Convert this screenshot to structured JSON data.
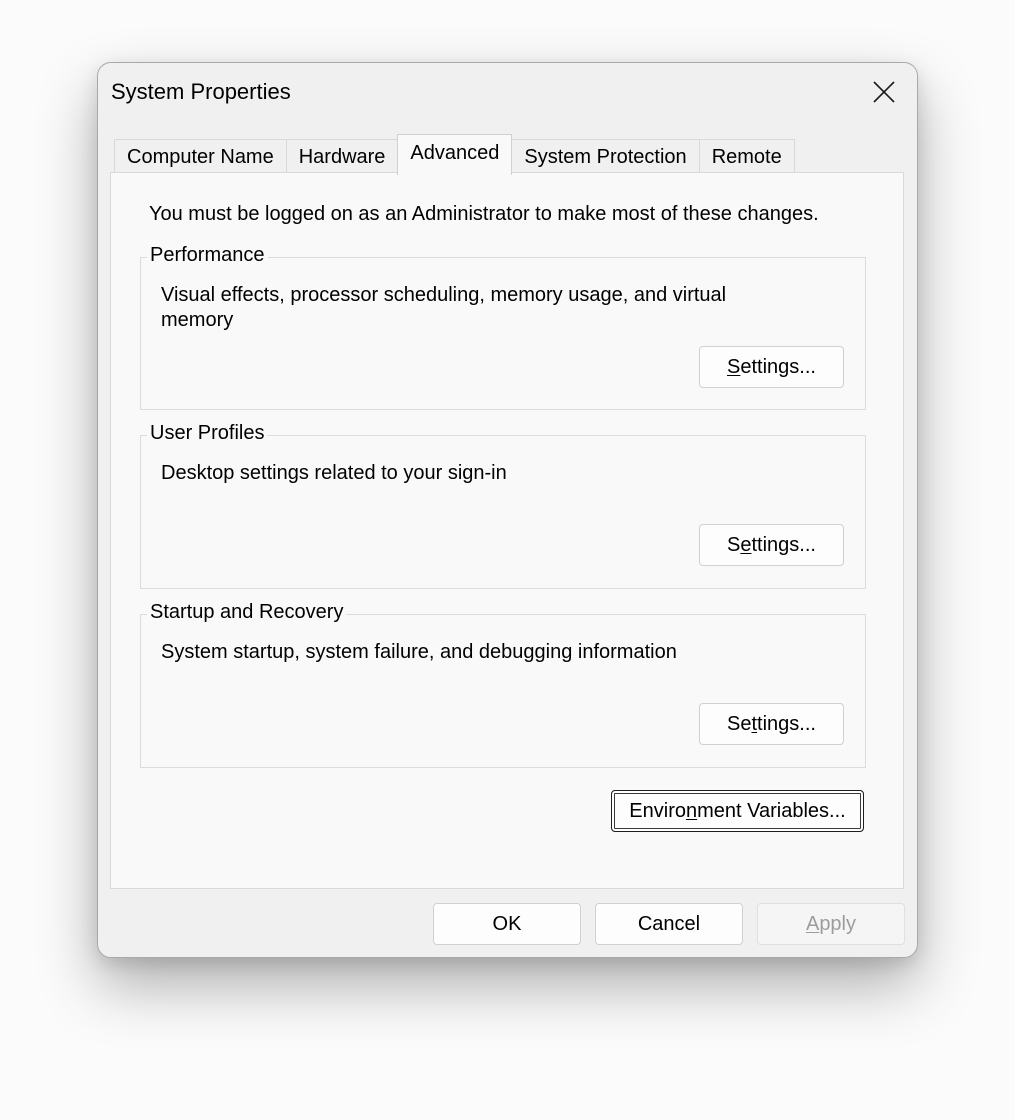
{
  "window": {
    "title": "System Properties",
    "close_icon": "close-icon"
  },
  "tabs": [
    {
      "label": "Computer Name",
      "active": false
    },
    {
      "label": "Hardware",
      "active": false
    },
    {
      "label": "Advanced",
      "active": true
    },
    {
      "label": "System Protection",
      "active": false
    },
    {
      "label": "Remote",
      "active": false
    }
  ],
  "advanced": {
    "admin_note": "You must be logged on as an Administrator to make most of these changes.",
    "performance": {
      "title": "Performance",
      "description": "Visual effects, processor scheduling, memory usage, and virtual memory",
      "button": {
        "pre": "",
        "key": "S",
        "post": "ettings..."
      }
    },
    "user_profiles": {
      "title": "User Profiles",
      "description": "Desktop settings related to your sign-in",
      "button": {
        "pre": "S",
        "key": "e",
        "post": "ttings..."
      }
    },
    "startup_recovery": {
      "title": "Startup and Recovery",
      "description": "System startup, system failure, and debugging information",
      "button": {
        "pre": "Se",
        "key": "t",
        "post": "tings..."
      }
    },
    "env_button": {
      "pre": "Enviro",
      "key": "n",
      "post": "ment Variables..."
    }
  },
  "footer": {
    "ok": "OK",
    "cancel": "Cancel",
    "apply": {
      "pre": "",
      "key": "A",
      "post": "pply"
    }
  },
  "colors": {
    "dialog_bg": "#f0f0f0",
    "panel_bg": "#f9f9f9",
    "disabled_text": "#9c9c9c"
  }
}
